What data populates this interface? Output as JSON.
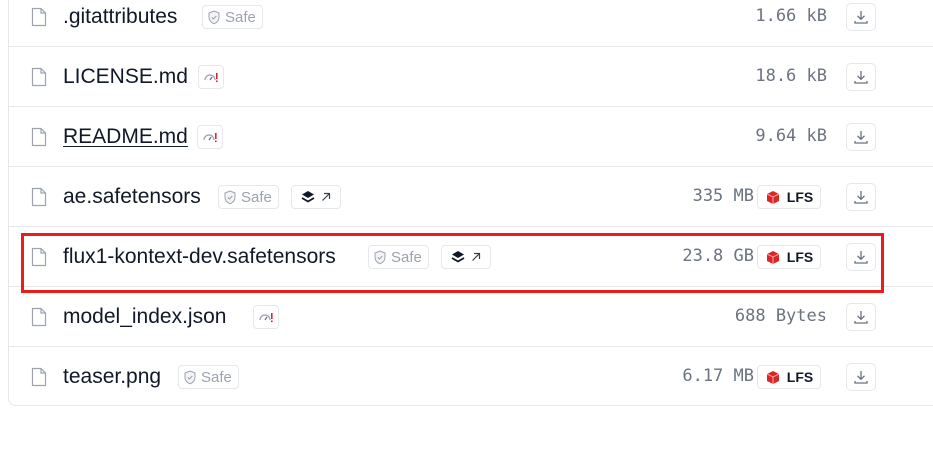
{
  "files": [
    {
      "name": ".gitattributes",
      "badge": "Safe",
      "size": "1.66 kB",
      "lfs": ""
    },
    {
      "name": "LICENSE.md",
      "size": "18.6 kB",
      "lfs": ""
    },
    {
      "name": "README.md",
      "size": "9.64 kB",
      "lfs": ""
    },
    {
      "name": "ae.safetensors",
      "badge": "Safe",
      "size": "335 MB",
      "lfs": "LFS"
    },
    {
      "name": "flux1-kontext-dev.safetensors",
      "badge": "Safe",
      "size": "23.8 GB",
      "lfs": "LFS"
    },
    {
      "name": "model_index.json",
      "size": "688 Bytes",
      "lfs": ""
    },
    {
      "name": "teaser.png",
      "badge": "Safe",
      "size": "6.17 MB",
      "lfs": "LFS"
    }
  ],
  "colors": {
    "highlight": "#ea1c1c",
    "lfs_icon": "#dc2626",
    "pickle_warning": "#dc2626"
  },
  "icons": {
    "file": "file-icon",
    "safe": "shield-check-icon",
    "pickle": "gauge-warning-icon",
    "viewer": "layers-icon",
    "external": "arrow-up-right-icon",
    "lfs": "lfs-cube-icon",
    "download": "download-icon"
  }
}
